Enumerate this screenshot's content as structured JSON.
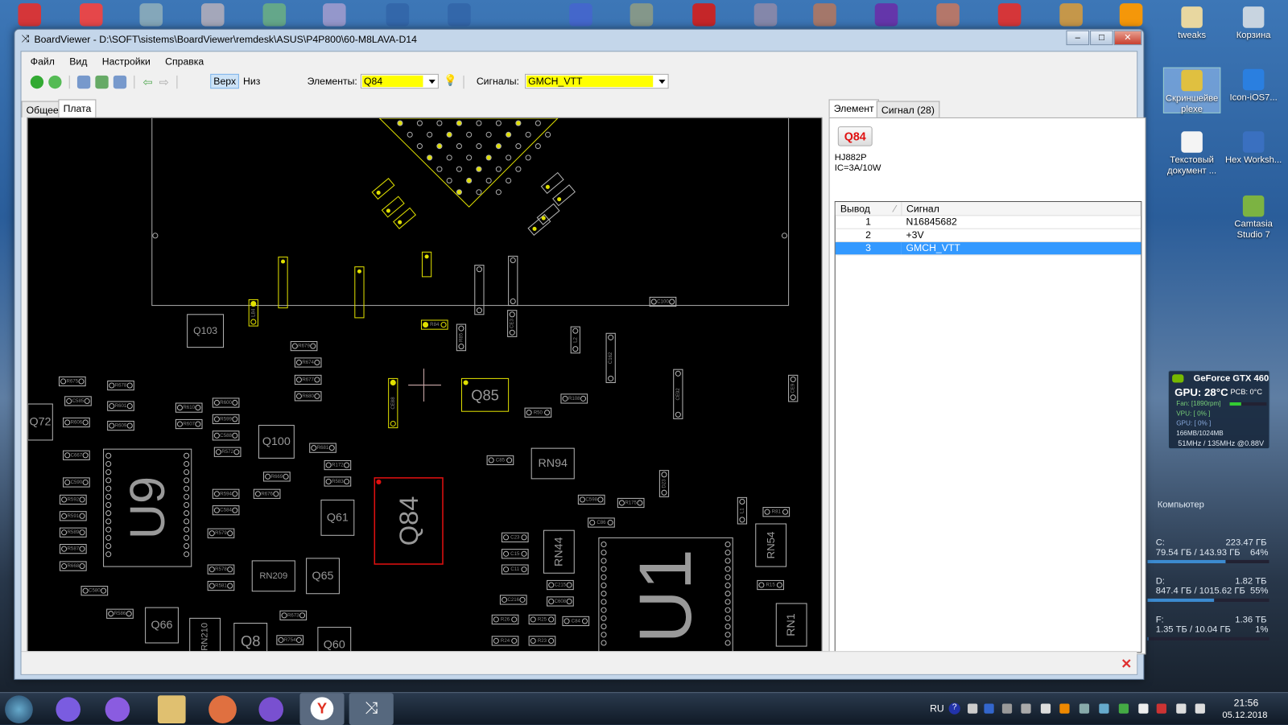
{
  "desktop": {
    "right_icons": [
      {
        "label": "tweaks"
      },
      {
        "label": "Корзина"
      },
      {
        "label": "Скриншейве рlexe"
      },
      {
        "label": "Icon-iOS7..."
      },
      {
        "label": "Текстовый документ ..."
      },
      {
        "label": "Hex Worksh..."
      },
      {
        "label": "Camtasia Studio 7"
      }
    ]
  },
  "window": {
    "app_name": "BoardViewer",
    "title": "BoardViewer  -  D:\\SOFT\\sistems\\BoardViewer\\remdesk\\ASUS\\P4P800\\60-M8LAVA-D14",
    "controls": {
      "minimize": "–",
      "maximize": "□",
      "close": "✕"
    }
  },
  "menu": [
    "Файл",
    "Вид",
    "Настройки",
    "Справка"
  ],
  "toolbar": {
    "top_label": "Верх",
    "bottom_label": "Низ",
    "elements_label": "Элементы:",
    "elements_value": "Q84",
    "signals_label": "Сигналы:",
    "signals_value": "GMCH_VTT",
    "highlight_color": "#ffff00"
  },
  "left_tabs": [
    "Общее",
    "Плата"
  ],
  "board": {
    "selected": "Q84",
    "components": [
      "U9",
      "Q84",
      "Q85",
      "Q103",
      "Q100",
      "Q72",
      "Q61",
      "Q65",
      "Q66",
      "Q8",
      "Q60",
      "RN209",
      "RN210",
      "RN94",
      "RN44",
      "RN54",
      "RN1",
      "U1",
      "R679",
      "R674",
      "R677",
      "R680",
      "R681",
      "R172",
      "R583",
      "R669",
      "R676",
      "R594",
      "C584",
      "R579",
      "R578",
      "R581",
      "R586",
      "C580",
      "R673",
      "R754",
      "R675",
      "R678",
      "C585",
      "R601",
      "R609",
      "R610",
      "R607",
      "R600",
      "R599",
      "C588",
      "R572",
      "R606",
      "R607",
      "C667",
      "C590",
      "R592",
      "R591",
      "R589",
      "R587",
      "R668",
      "R50",
      "R108",
      "C598",
      "R175",
      "D23",
      "CE92",
      "CE9",
      "L2",
      "C162",
      "CE3",
      "R85",
      "R84",
      "C100",
      "L84",
      "CE88",
      "L1",
      "R81",
      "R15",
      "C23",
      "C15",
      "C11",
      "C215",
      "C608",
      "C216",
      "R26",
      "R25",
      "R24",
      "R23",
      "C84",
      "C86",
      "C85"
    ],
    "colors": {
      "selected": "#e01010",
      "net": "#e0e000",
      "part": "#b4b4b4",
      "bg": "#000000"
    }
  },
  "right_tabs": [
    "Элемент",
    "Сигнал (28)"
  ],
  "element": {
    "name": "Q84",
    "part": "HJ882P",
    "desc": "IC=3A/10W",
    "columns": [
      "Вывод",
      "Сигнал"
    ],
    "pins": [
      {
        "pin": "1",
        "signal": "N16845682"
      },
      {
        "pin": "2",
        "signal": "+3V"
      },
      {
        "pin": "3",
        "signal": "GMCH_VTT"
      }
    ],
    "selected_pin": "3"
  },
  "gadgets": {
    "gpu": {
      "name": "GeForce GTX 460",
      "temp": "GPU: 28°C",
      "pcb": "PCB: 0°C",
      "fan": "Fan: [1890rpm]",
      "vpu": "VPU: [ 0% ]",
      "gpu_load": "GPU: [ 0% ]",
      "mem": "166MB/1024MB",
      "clock": "51MHz / 135MHz @0.88V"
    },
    "computer": {
      "title": "Компьютер",
      "drives": [
        {
          "letter": "C:",
          "total": "223.47 ГБ",
          "used": "79.54 ГБ / 143.93 ГБ",
          "pct": "64%",
          "fill": 64
        },
        {
          "letter": "D:",
          "total": "1.82 ТБ",
          "used": "847.4 ГБ / 1015.62 ГБ",
          "pct": "55%",
          "fill": 55
        },
        {
          "letter": "F:",
          "total": "1.36 ТБ",
          "used": "1.35 ТБ / 10.04 ГБ",
          "pct": "1%",
          "fill": 1
        }
      ]
    }
  },
  "taskbar": {
    "lang": "RU",
    "time": "21:56",
    "date": "05.12.2018"
  }
}
